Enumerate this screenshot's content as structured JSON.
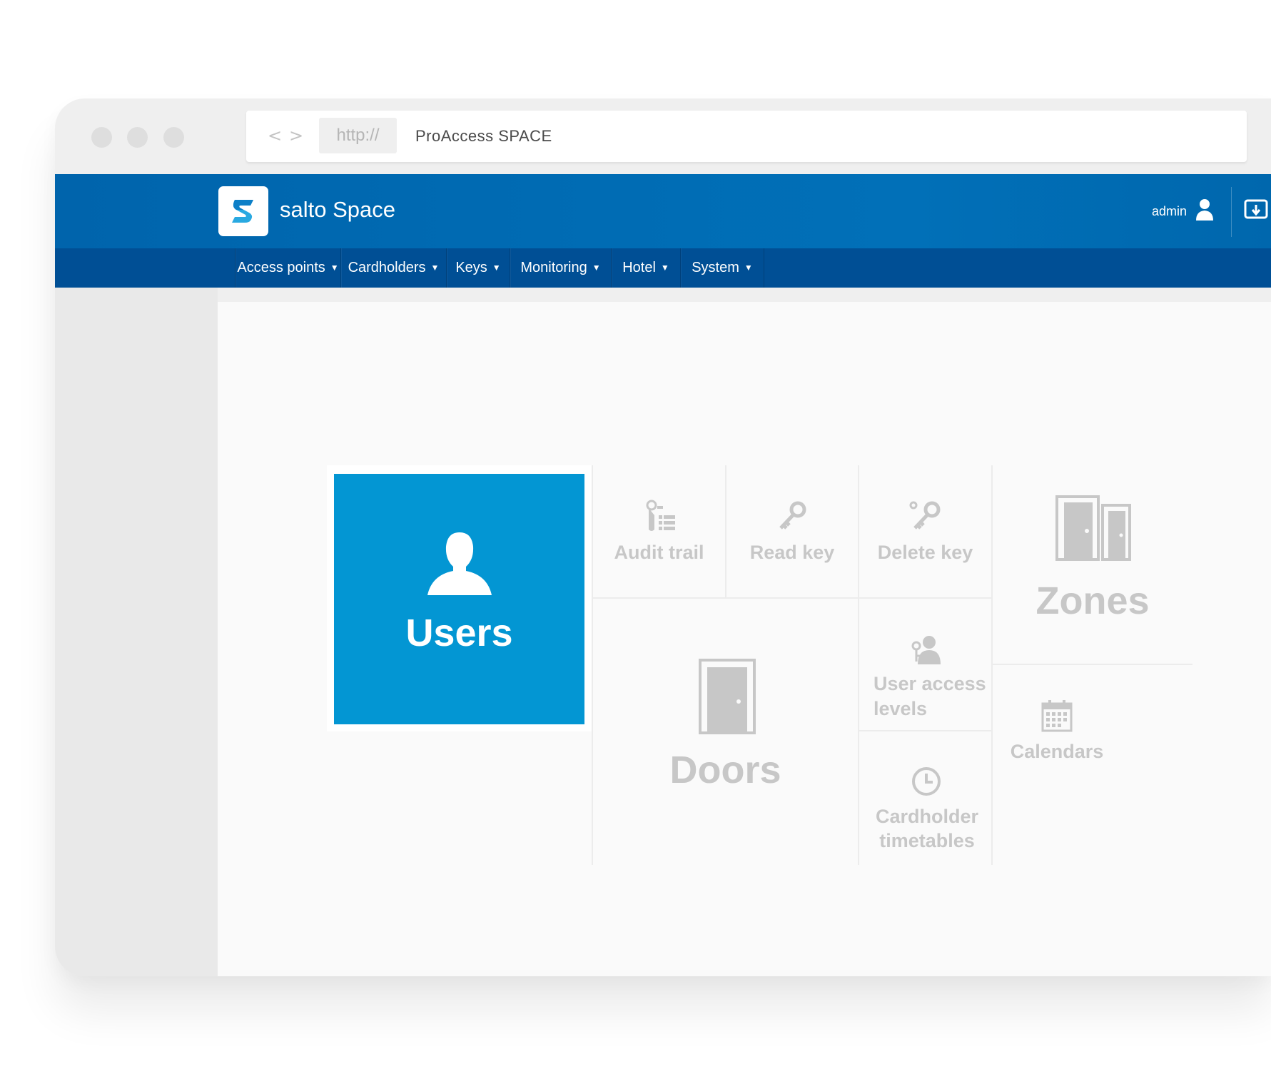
{
  "browser": {
    "nav_back": "<",
    "nav_forward": ">",
    "protocol": "http://",
    "url_title": "ProAccess SPACE"
  },
  "header": {
    "brand": "salto Space",
    "logo_icon": "salto-s-logo",
    "user_name": "admin",
    "user_icon": "user-icon",
    "logout_icon": "logout-icon"
  },
  "nav": {
    "items": [
      {
        "label": "Access points"
      },
      {
        "label": "Cardholders"
      },
      {
        "label": "Keys"
      },
      {
        "label": "Monitoring"
      },
      {
        "label": "Hotel"
      },
      {
        "label": "System"
      }
    ]
  },
  "dashboard": {
    "tiles": {
      "users": "Users",
      "audit_trail": "Audit trail",
      "read_key": "Read key",
      "delete_key": "Delete key",
      "zones": "Zones",
      "doors": "Doors",
      "user_access_levels": "User access levels",
      "calendars": "Calendars",
      "cardholder_timetables": "Cardholder timetables"
    }
  },
  "colors": {
    "header_blue": "#0067ad",
    "nav_blue": "#004f95",
    "users_tile": "#0396d3",
    "tile_gray": "#c7c7c7"
  }
}
